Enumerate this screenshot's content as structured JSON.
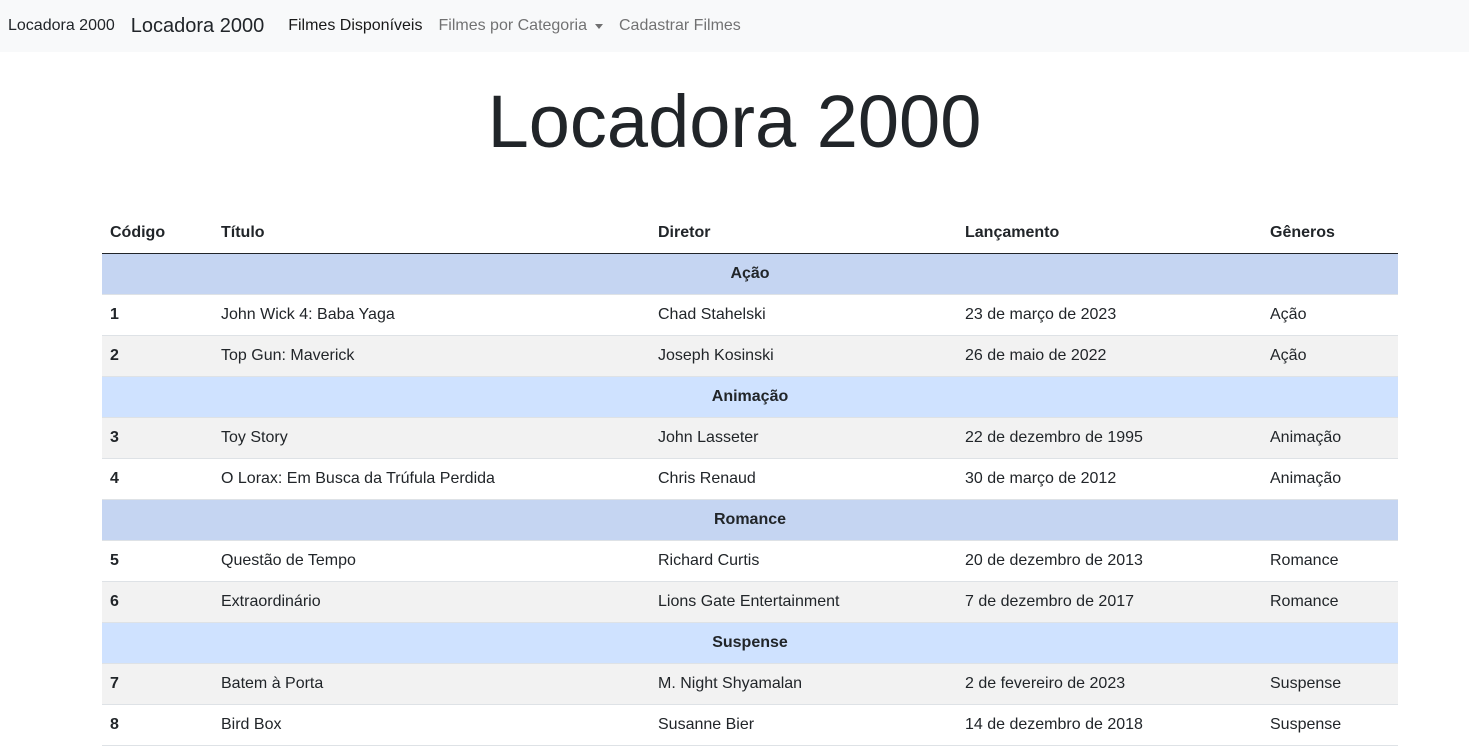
{
  "navbar": {
    "logo_alt": "Locadora 2000",
    "brand": "Locadora 2000",
    "links": [
      {
        "label": "Filmes Disponíveis"
      },
      {
        "label": "Filmes por Categoria"
      },
      {
        "label": "Cadastrar Filmes"
      }
    ]
  },
  "page_title": "Locadora 2000",
  "table": {
    "headers": [
      "Código",
      "Título",
      "Diretor",
      "Lançamento",
      "Gêneros"
    ],
    "groups": [
      {
        "name": "Ação",
        "rows": [
          {
            "code": "1",
            "title": "John Wick 4: Baba Yaga",
            "director": "Chad Stahelski",
            "release": "23 de março de 2023",
            "genre": "Ação"
          },
          {
            "code": "2",
            "title": "Top Gun: Maverick",
            "director": "Joseph Kosinski",
            "release": "26 de maio de 2022",
            "genre": "Ação"
          }
        ]
      },
      {
        "name": "Animação",
        "rows": [
          {
            "code": "3",
            "title": "Toy Story",
            "director": "John Lasseter",
            "release": "22 de dezembro de 1995",
            "genre": "Animação"
          },
          {
            "code": "4",
            "title": "O Lorax: Em Busca da Trúfula Perdida",
            "director": "Chris Renaud",
            "release": "30 de março de 2012",
            "genre": "Animação"
          }
        ]
      },
      {
        "name": "Romance",
        "rows": [
          {
            "code": "5",
            "title": "Questão de Tempo",
            "director": "Richard Curtis",
            "release": "20 de dezembro de 2013",
            "genre": "Romance"
          },
          {
            "code": "6",
            "title": "Extraordinário",
            "director": "Lions Gate Entertainment",
            "release": "7 de dezembro de 2017",
            "genre": "Romance"
          }
        ]
      },
      {
        "name": "Suspense",
        "rows": [
          {
            "code": "7",
            "title": "Batem à Porta",
            "director": "M. Night Shyamalan",
            "release": "2 de fevereiro de 2023",
            "genre": "Suspense"
          },
          {
            "code": "8",
            "title": "Bird Box",
            "director": "Susanne Bier",
            "release": "14 de dezembro de 2018",
            "genre": "Suspense"
          }
        ]
      }
    ]
  },
  "colors": {
    "group_dark": "#c5d5f2",
    "group_light": "#cfe2ff",
    "stripe": "#f2f2f2",
    "navbar_bg": "#f8f9fa"
  }
}
